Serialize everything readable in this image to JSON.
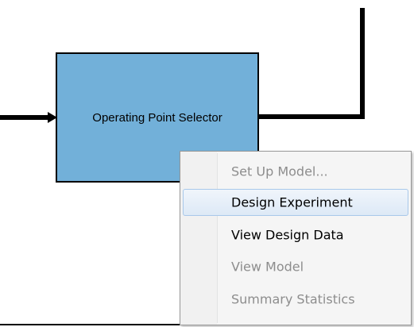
{
  "block": {
    "label": "Operating Point Selector",
    "fill_color": "#72b0d9"
  },
  "context_menu": {
    "items": [
      {
        "label": "Set Up Model...",
        "enabled": false
      },
      {
        "label": "Design Experiment",
        "enabled": true,
        "hovered": true
      },
      {
        "label": "View Design Data",
        "enabled": true
      },
      {
        "label": "View Model",
        "enabled": false
      },
      {
        "label": "Summary Statistics",
        "enabled": false
      }
    ]
  },
  "colors": {
    "menu_hover_border": "#a8c8ea",
    "disabled_text": "#8d8d8d",
    "wire": "#000000"
  }
}
